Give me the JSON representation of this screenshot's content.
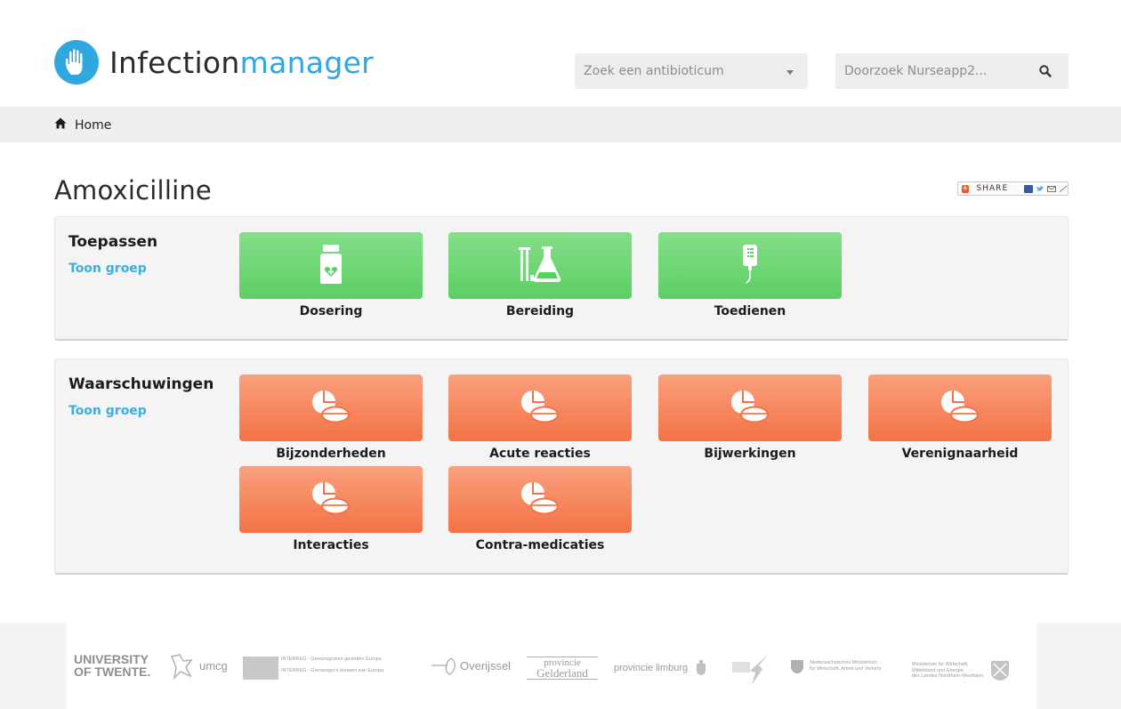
{
  "header": {
    "brand_part1": "Infection",
    "brand_part2": "manager",
    "antibiotic_select": {
      "value": "Zoek een antibioticum"
    },
    "search": {
      "placeholder": "Doorzoek Nurseapp2..."
    }
  },
  "breadcrumb": {
    "home_label": "Home"
  },
  "page": {
    "title": "Amoxicilline",
    "share_label": "SHARE"
  },
  "sections": [
    {
      "title": "Toepassen",
      "link": "Toon groep",
      "tiles": [
        {
          "label": "Dosering",
          "icon": "medicine-bottle-icon"
        },
        {
          "label": "Bereiding",
          "icon": "lab-flask-icon"
        },
        {
          "label": "Toedienen",
          "icon": "iv-drip-icon"
        }
      ]
    },
    {
      "title": "Waarschuwingen",
      "link": "Toon groep",
      "tiles": [
        {
          "label": "Bijzonderheden",
          "icon": "pills-icon"
        },
        {
          "label": "Acute reacties",
          "icon": "pills-icon"
        },
        {
          "label": "Bijwerkingen",
          "icon": "pills-icon"
        },
        {
          "label": "Verenignaarheid",
          "icon": "pills-icon"
        },
        {
          "label": "Interacties",
          "icon": "pills-icon"
        },
        {
          "label": "Contra-medicaties",
          "icon": "pills-icon"
        }
      ]
    }
  ],
  "footer": {
    "logos": [
      {
        "line1": "UNIVERSITY",
        "line2": "OF TWENTE."
      },
      {
        "text": "umcg"
      },
      {
        "line1": "INTERREG - Grenzregionen gestalten Europa",
        "line2": "INTERREG - Grensregio's bouwen aan Europa"
      },
      {
        "text": "Overijssel"
      },
      {
        "line1": "provincie",
        "line2": "Gelderland"
      },
      {
        "text": "provincie limburg"
      },
      {
        "line1": "Niedersächsisches Ministerium",
        "line2": "für Wirtschaft, Arbeit und Verkehr"
      },
      {
        "line1": "Ministerium für Wirtschaft,",
        "line2": "Mittelstand und Energie",
        "line3": "des Landes Nordrhein-Westfalen"
      }
    ]
  },
  "colors": {
    "brand_blue": "#2fa8e0",
    "tile_green": "#5ccf64",
    "tile_orange": "#f47246",
    "link_blue": "#3ab0de"
  }
}
